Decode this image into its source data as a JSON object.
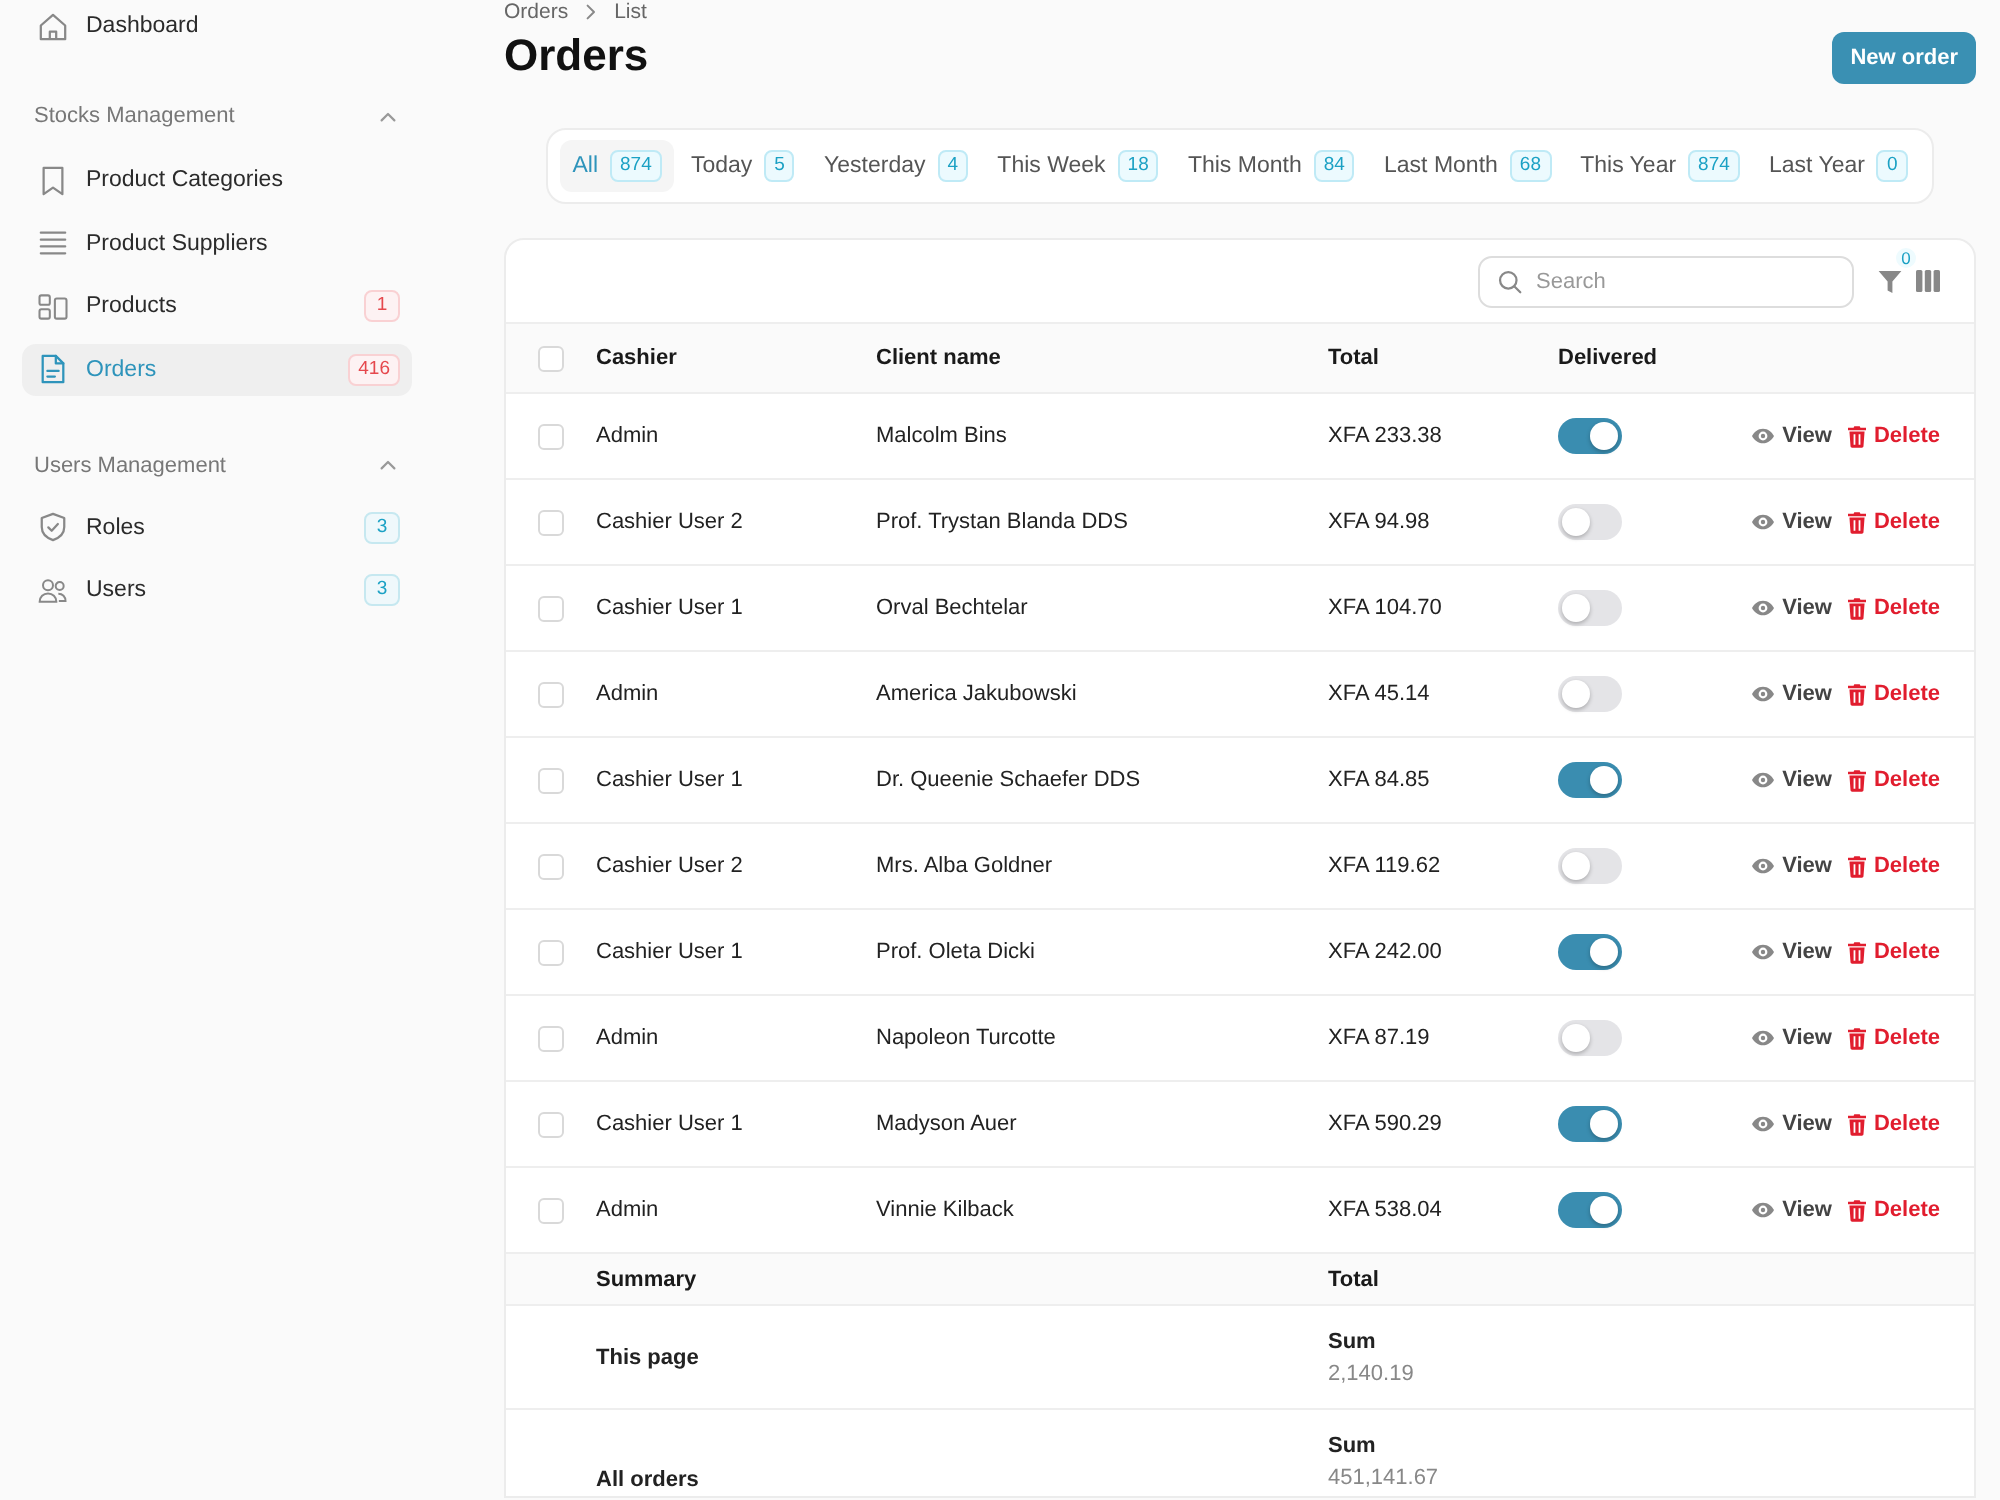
{
  "sidebar": {
    "top_items": [
      {
        "label": "Dashboard",
        "selected": false
      }
    ],
    "sections": [
      {
        "title": "Stocks Management",
        "expanded": true,
        "items": [
          {
            "label": "Product Categories",
            "selected": false
          },
          {
            "label": "Product Suppliers",
            "selected": false
          },
          {
            "label": "Products",
            "selected": false,
            "badge": "1",
            "color": "#e5484d"
          },
          {
            "label": "Orders",
            "selected": true,
            "badge": "416",
            "color": "#e5484d"
          }
        ]
      },
      {
        "title": "Users Management",
        "expanded": true,
        "items": [
          {
            "label": "Roles",
            "selected": false,
            "badge": "3",
            "color": "#1ba1c4"
          },
          {
            "label": "Users",
            "selected": false,
            "badge": "3",
            "color": "#1ba1c4"
          }
        ]
      }
    ]
  },
  "breadcrumb": [
    "Orders",
    "List"
  ],
  "page": {
    "title": "Orders",
    "primary_action": "New order"
  },
  "tabs": [
    {
      "label": "All",
      "count": "874",
      "selected": true
    },
    {
      "label": "Today",
      "count": "5",
      "selected": false
    },
    {
      "label": "Yesterday",
      "count": "4",
      "selected": false
    },
    {
      "label": "This Week",
      "count": "18",
      "selected": false
    },
    {
      "label": "This Month",
      "count": "84",
      "selected": false
    },
    {
      "label": "Last Month",
      "count": "68",
      "selected": false
    },
    {
      "label": "This Year",
      "count": "874",
      "selected": false
    },
    {
      "label": "Last Year",
      "count": "0",
      "selected": false
    }
  ],
  "toolbar": {
    "search": {
      "placeholder": "Search"
    },
    "filter_count": "0"
  },
  "table": {
    "header_checked": false,
    "columns": [
      "Cashier",
      "Client name",
      "Total",
      "Delivered"
    ],
    "rows": [
      {
        "checked": false,
        "cashier": "Admin",
        "client": "Malcolm Bins",
        "total": "XFA 233.38",
        "delivered": true,
        "actions": [
          {
            "kind": "view",
            "label": "View"
          },
          {
            "kind": "delete",
            "label": "Delete"
          }
        ]
      },
      {
        "checked": false,
        "cashier": "Cashier User 2",
        "client": "Prof. Trystan Blanda DDS",
        "total": "XFA 94.98",
        "delivered": false,
        "actions": [
          {
            "kind": "view",
            "label": "View"
          },
          {
            "kind": "delete",
            "label": "Delete"
          }
        ]
      },
      {
        "checked": false,
        "cashier": "Cashier User 1",
        "client": "Orval Bechtelar",
        "total": "XFA 104.70",
        "delivered": false,
        "actions": [
          {
            "kind": "view",
            "label": "View"
          },
          {
            "kind": "delete",
            "label": "Delete"
          }
        ]
      },
      {
        "checked": false,
        "cashier": "Admin",
        "client": "America Jakubowski",
        "total": "XFA 45.14",
        "delivered": false,
        "actions": [
          {
            "kind": "view",
            "label": "View"
          },
          {
            "kind": "delete",
            "label": "Delete"
          }
        ]
      },
      {
        "checked": false,
        "cashier": "Cashier User 1",
        "client": "Dr. Queenie Schaefer DDS",
        "total": "XFA 84.85",
        "delivered": true,
        "actions": [
          {
            "kind": "view",
            "label": "View"
          },
          {
            "kind": "delete",
            "label": "Delete"
          }
        ]
      },
      {
        "checked": false,
        "cashier": "Cashier User 2",
        "client": "Mrs. Alba Goldner",
        "total": "XFA 119.62",
        "delivered": false,
        "actions": [
          {
            "kind": "view",
            "label": "View"
          },
          {
            "kind": "delete",
            "label": "Delete"
          }
        ]
      },
      {
        "checked": false,
        "cashier": "Cashier User 1",
        "client": "Prof. Oleta Dicki",
        "total": "XFA 242.00",
        "delivered": true,
        "actions": [
          {
            "kind": "view",
            "label": "View"
          },
          {
            "kind": "delete",
            "label": "Delete"
          }
        ]
      },
      {
        "checked": false,
        "cashier": "Admin",
        "client": "Napoleon Turcotte",
        "total": "XFA 87.19",
        "delivered": false,
        "actions": [
          {
            "kind": "view",
            "label": "View"
          },
          {
            "kind": "delete",
            "label": "Delete"
          }
        ]
      },
      {
        "checked": false,
        "cashier": "Cashier User 1",
        "client": "Madyson Auer",
        "total": "XFA 590.29",
        "delivered": true,
        "actions": [
          {
            "kind": "view",
            "label": "View"
          },
          {
            "kind": "delete",
            "label": "Delete"
          }
        ]
      },
      {
        "checked": false,
        "cashier": "Admin",
        "client": "Vinnie Kilback",
        "total": "XFA 538.04",
        "delivered": true,
        "actions": [
          {
            "kind": "view",
            "label": "View"
          },
          {
            "kind": "delete",
            "label": "Delete"
          }
        ]
      }
    ],
    "summary": {
      "columns": [
        "Summary",
        "Total"
      ],
      "rows": [
        {
          "label": "This page",
          "sum_label": "Sum",
          "value": "2,140.19"
        },
        {
          "label": "All orders",
          "sum_label": "Sum",
          "value": "451,141.67"
        }
      ]
    }
  }
}
